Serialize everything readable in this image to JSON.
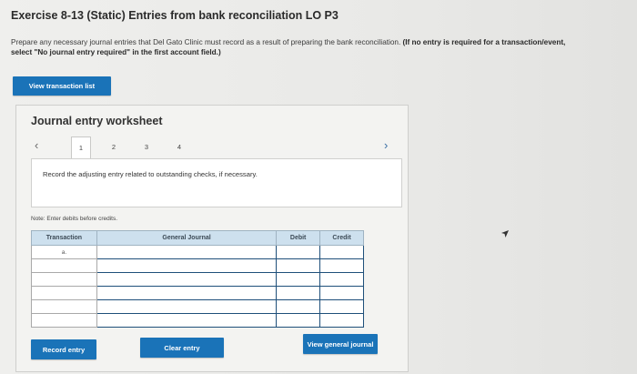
{
  "header": {
    "title": "Exercise 8-13 (Static) Entries from bank reconciliation LO P3",
    "instructions_plain": "Prepare any necessary journal entries that Del Gato Clinic must record as a result of preparing the bank reconciliation.",
    "instructions_bold": "(If no entry is required for a transaction/event, select \"No journal entry required\" in the first account field.)"
  },
  "toolbar": {
    "view_transaction_list": "View transaction list"
  },
  "worksheet": {
    "title": "Journal entry worksheet",
    "tabs": [
      "1",
      "2",
      "3",
      "4"
    ],
    "active_tab": "1",
    "prompt": "Record the adjusting entry related to outstanding checks, if necessary.",
    "note": "Note: Enter debits before credits.",
    "columns": [
      "Transaction",
      "General Journal",
      "Debit",
      "Credit"
    ],
    "rows": [
      {
        "transaction": "a.",
        "general": "",
        "debit": "",
        "credit": ""
      },
      {
        "transaction": "",
        "general": "",
        "debit": "",
        "credit": ""
      },
      {
        "transaction": "",
        "general": "",
        "debit": "",
        "credit": ""
      },
      {
        "transaction": "",
        "general": "",
        "debit": "",
        "credit": ""
      },
      {
        "transaction": "",
        "general": "",
        "debit": "",
        "credit": ""
      },
      {
        "transaction": "",
        "general": "",
        "debit": "",
        "credit": ""
      }
    ],
    "buttons": {
      "record": "Record entry",
      "clear": "Clear entry",
      "view_general_journal": "View general journal"
    }
  },
  "colors": {
    "button_blue": "#1a73b8",
    "header_blue": "#cde0ee",
    "cell_border_active": "#1e4f7a"
  },
  "icons": {
    "prev": "chevron-left-icon",
    "next": "chevron-right-icon",
    "cursor": "mouse-cursor-icon"
  }
}
